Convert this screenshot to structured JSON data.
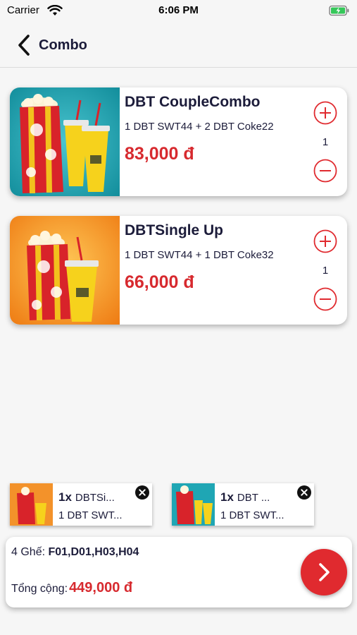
{
  "status_bar": {
    "carrier": "Carrier",
    "time": "6:06 PM"
  },
  "nav": {
    "title": "Combo"
  },
  "combos": [
    {
      "name": "DBT CoupleCombo",
      "description": "1 DBT SWT44 + 2 DBT Coke22",
      "price": "83,000 đ",
      "quantity": "1",
      "image_bg": "#1fa6b4"
    },
    {
      "name": "DBTSingle Up",
      "description": "1 DBT SWT44 + 1 DBT Coke32",
      "price": "66,000 đ",
      "quantity": "1",
      "image_bg": "#f08a1c"
    }
  ],
  "cart_items": [
    {
      "count": "1x",
      "name": "DBTSi...",
      "detail": "1 DBT SWT...",
      "image_bg": "#f08a1c"
    },
    {
      "count": "1x",
      "name": "DBT ...",
      "detail": "1 DBT SWT...",
      "image_bg": "#1fa6b4"
    }
  ],
  "summary": {
    "seats_label": "4 Ghế:",
    "seats_value": "F01,D01,H03,H04",
    "total_label": "Tổng cộng:",
    "total_value": "449,000 đ"
  },
  "colors": {
    "accent_red": "#e02a2f",
    "price_red": "#d72a2f",
    "text_navy": "#1c1c3a"
  },
  "icons": [
    "wifi-icon",
    "battery-icon",
    "back-chevron-icon",
    "plus-circle-icon",
    "minus-circle-icon",
    "close-circle-icon",
    "chevron-right-icon"
  ]
}
